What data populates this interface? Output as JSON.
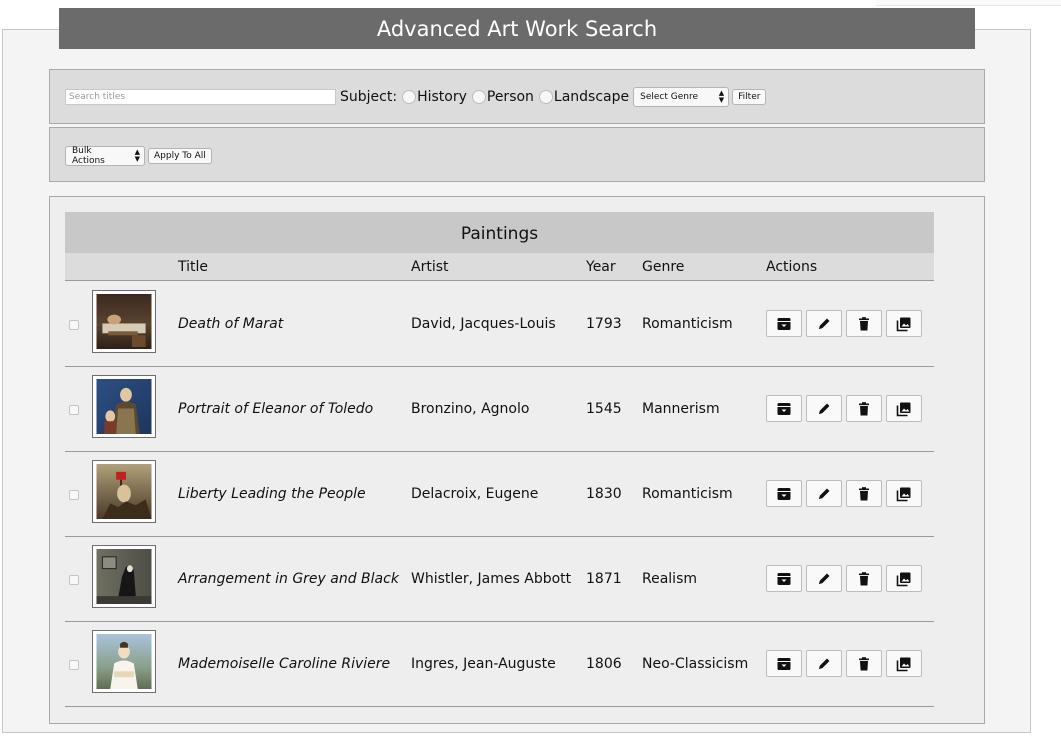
{
  "app": {
    "title": "Advanced Art Work Search"
  },
  "filter": {
    "search_placeholder": "Search titles",
    "subject_label": "Subject:",
    "subjects": [
      "History",
      "Person",
      "Landscape"
    ],
    "genre_select": "Select Genre",
    "filter_button": "Filter"
  },
  "bulk": {
    "select_label": "Bulk Actions",
    "apply_button": "Apply To All"
  },
  "table": {
    "caption": "Paintings",
    "columns": [
      "Title",
      "Artist",
      "Year",
      "Genre",
      "Actions"
    ],
    "rows": [
      {
        "title": "Death of Marat",
        "artist": "David, Jacques-Louis",
        "year": "1793",
        "genre": "Romanticism",
        "thumb": "death-of-marat"
      },
      {
        "title": "Portrait of Eleanor of Toledo",
        "artist": "Bronzino, Agnolo",
        "year": "1545",
        "genre": "Mannerism",
        "thumb": "eleanor-of-toledo"
      },
      {
        "title": "Liberty Leading the People",
        "artist": "Delacroix, Eugene",
        "year": "1830",
        "genre": "Romanticism",
        "thumb": "liberty-leading"
      },
      {
        "title": "Arrangement in Grey and Black",
        "artist": "Whistler, James Abbott",
        "year": "1871",
        "genre": "Realism",
        "thumb": "whistlers-mother"
      },
      {
        "title": "Mademoiselle Caroline Riviere",
        "artist": "Ingres, Jean-Auguste",
        "year": "1806",
        "genre": "Neo-Classicism",
        "thumb": "caroline-riviere"
      }
    ],
    "action_icons": [
      "archive-icon",
      "edit-icon",
      "delete-icon",
      "image-icon"
    ]
  }
}
